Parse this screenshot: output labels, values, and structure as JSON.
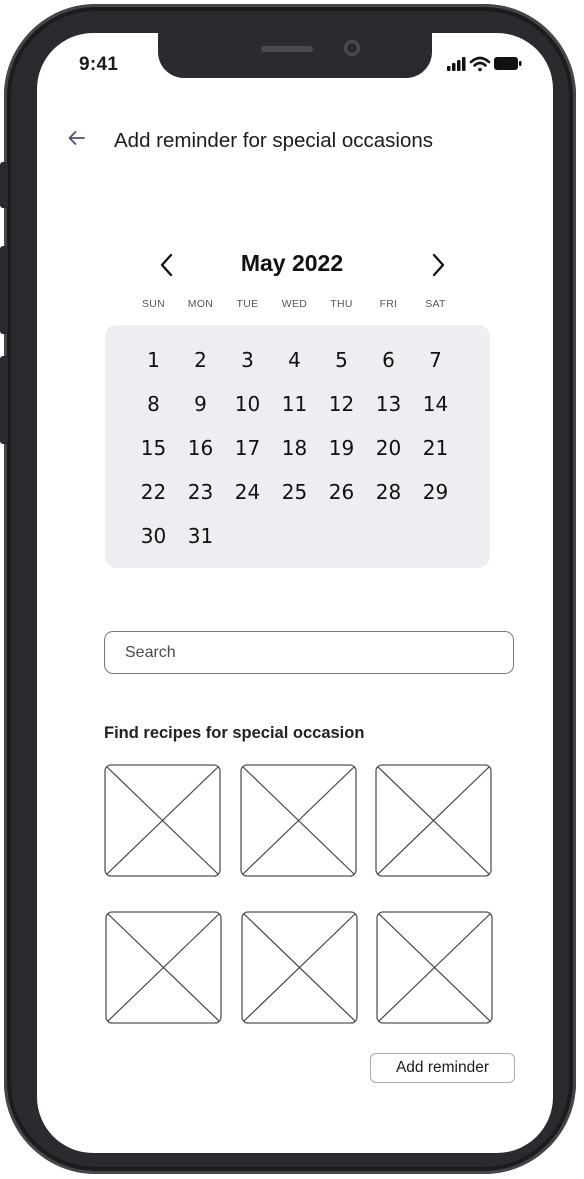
{
  "status_bar": {
    "time": "9:41",
    "icons": [
      "signal-icon",
      "wifi-icon",
      "battery-icon"
    ]
  },
  "header": {
    "back_icon": "arrow-left-icon",
    "title": "Add reminder for special occasions"
  },
  "calendar": {
    "month_label": "May 2022",
    "prev_icon": "chevron-left-icon",
    "next_icon": "chevron-right-icon",
    "weekdays": [
      "SUN",
      "MON",
      "TUE",
      "WED",
      "THU",
      "FRI",
      "SAT"
    ],
    "weeks": [
      [
        "1",
        "2",
        "3",
        "4",
        "5",
        "6",
        "7"
      ],
      [
        "8",
        "9",
        "10",
        "11",
        "12",
        "13",
        "14"
      ],
      [
        "15",
        "16",
        "17",
        "18",
        "19",
        "20",
        "21"
      ],
      [
        "22",
        "23",
        "24",
        "25",
        "26",
        "28",
        "29"
      ],
      [
        "30",
        "31"
      ]
    ]
  },
  "search": {
    "placeholder": "Search",
    "value": ""
  },
  "recipes": {
    "title": "Find recipes for special occasion",
    "tile_count": 6
  },
  "actions": {
    "add_reminder_label": "Add reminder"
  },
  "colors": {
    "frame": "#2a2b2e",
    "calendar_bg": "#ededf2",
    "back_arrow": "#4a5170"
  }
}
